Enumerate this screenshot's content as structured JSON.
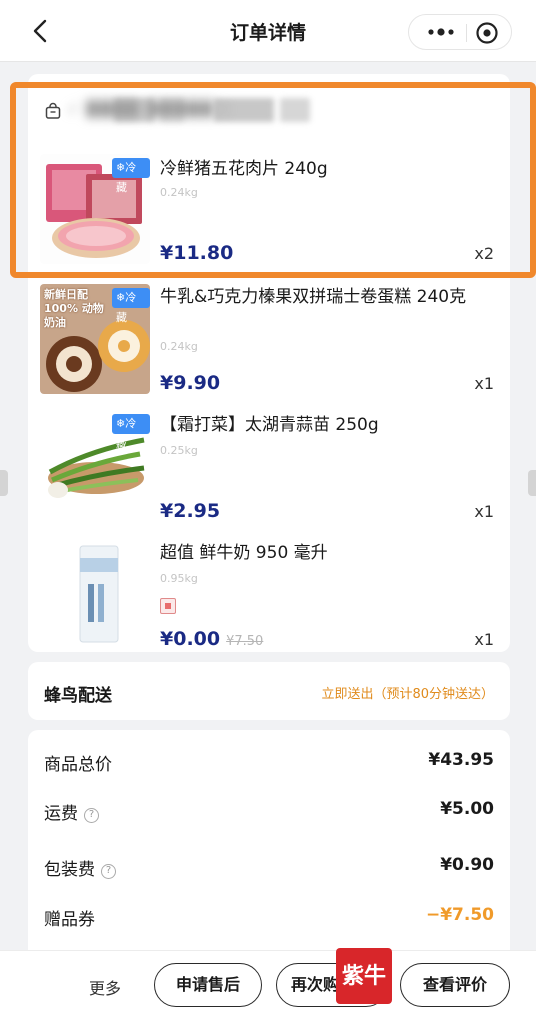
{
  "header": {
    "title": "订单详情",
    "back_icon": "chevron-left-icon",
    "more_icon": "more-dots-icon",
    "close_icon": "target-circle-icon"
  },
  "shop": {
    "icon": "shopping-bag-icon",
    "name": "√ ████ █████ )"
  },
  "items": [
    {
      "tag": "❄冷藏",
      "name": "冷鲜猪五花肉片 240g",
      "weight": "0.24kg",
      "price": "¥11.80",
      "qty": "x2"
    },
    {
      "tag": "❄冷藏",
      "name": "牛乳&巧克力榛果双拼瑞士卷蛋糕 240克",
      "weight": "0.24kg",
      "price": "¥9.90",
      "qty": "x1",
      "thumb_text": "新鲜日配 100% 动物奶油"
    },
    {
      "tag": "❄冷藏",
      "name": "【霜打菜】太湖青蒜苗 250g",
      "weight": "0.25kg",
      "price": "¥2.95",
      "qty": "x1"
    },
    {
      "name": "超值 鲜牛奶 950 毫升",
      "weight": "0.95kg",
      "price": "¥0.00",
      "original_price": "¥7.50",
      "qty": "x1",
      "gift_icon": "gift-badge-icon"
    }
  ],
  "delivery": {
    "label": "蜂鸟配送",
    "info": "立即送出（预计80分钟送达）"
  },
  "summary": {
    "rows": [
      {
        "label": "商品总价",
        "value": "¥43.95"
      },
      {
        "label": "运费",
        "value": "¥5.00",
        "help": "?"
      },
      {
        "label": "包装费",
        "value": "¥0.90",
        "help": "?"
      },
      {
        "label": "赠品券",
        "value": "−¥7.50"
      }
    ]
  },
  "actions": {
    "more": "更多",
    "after_sale": "申请售后",
    "reorder": "再次购",
    "review": "查看评价"
  },
  "watermark": "紫牛",
  "colors": {
    "price": "#1a2a84",
    "highlight": "#f0882c",
    "delivery_info": "#e08b1c",
    "coupon": "#f09a2a",
    "cold_tag": "#3d8ef5"
  }
}
